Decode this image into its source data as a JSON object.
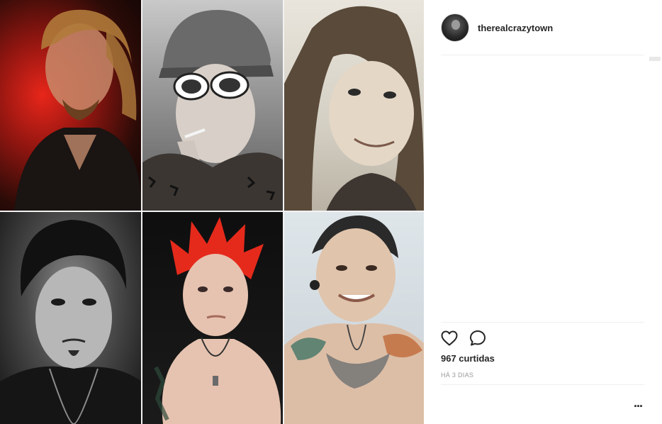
{
  "post": {
    "username": "therealcrazytown",
    "likes_text": "967 curtidas",
    "timestamp": "HÁ 3 DIAS"
  },
  "actions": {
    "like_icon": "heart-icon",
    "comment_icon": "comment-icon",
    "more_icon": "ellipsis-icon",
    "more_label": "..."
  },
  "media": {
    "tiles": [
      "photo-1",
      "photo-2",
      "photo-3",
      "photo-4",
      "photo-5",
      "photo-6"
    ]
  }
}
